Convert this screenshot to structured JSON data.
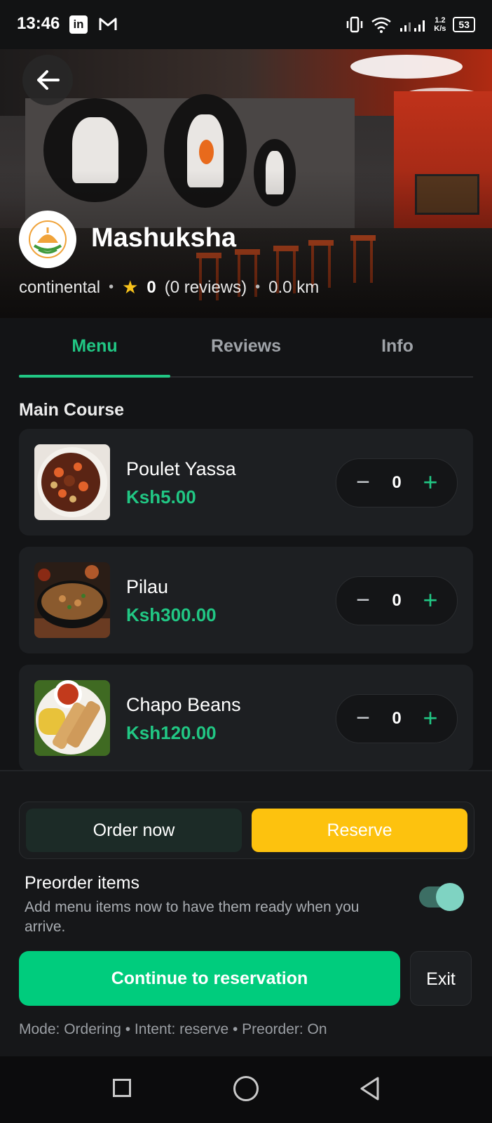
{
  "status_bar": {
    "time": "13:46",
    "linkedin_icon_text": "in",
    "speed": "1.2",
    "speed_unit": "K/s",
    "battery": "53"
  },
  "restaurant": {
    "name": "Mashuksha",
    "cuisine": "continental",
    "rating": "0",
    "reviews": "(0 reviews)",
    "distance": "0.0 km"
  },
  "tabs": [
    {
      "label": "Menu",
      "active": true
    },
    {
      "label": "Reviews",
      "active": false
    },
    {
      "label": "Info",
      "active": false
    }
  ],
  "section": {
    "title": "Main Course"
  },
  "menu_items": [
    {
      "name": "Poulet Yassa",
      "price": "Ksh5.00",
      "qty": "0"
    },
    {
      "name": "Pilau",
      "price": "Ksh300.00",
      "qty": "0"
    },
    {
      "name": "Chapo Beans",
      "price": "Ksh120.00",
      "qty": "0"
    }
  ],
  "stepper": {
    "minus": "−",
    "plus": "+"
  },
  "actions": {
    "order_now": "Order now",
    "reserve": "Reserve",
    "selected_intent": "reserve"
  },
  "preorder": {
    "title": "Preorder items",
    "description": "Add menu items now to have them ready when you arrive.",
    "enabled": true
  },
  "buttons": {
    "continue": "Continue to reservation",
    "exit": "Exit"
  },
  "mode_line": "Mode: Ordering • Intent: reserve • Preorder: On",
  "colors": {
    "accent_green": "#21c784",
    "primary_button": "#00cc7d",
    "reserve_yellow": "#fdc20e",
    "star": "#f7c21b",
    "background": "#131416"
  },
  "icons": {
    "back": "arrow-left-icon",
    "star": "star-icon",
    "nav_recents": "square-icon",
    "nav_home": "circle-icon",
    "nav_back": "triangle-back-icon"
  }
}
